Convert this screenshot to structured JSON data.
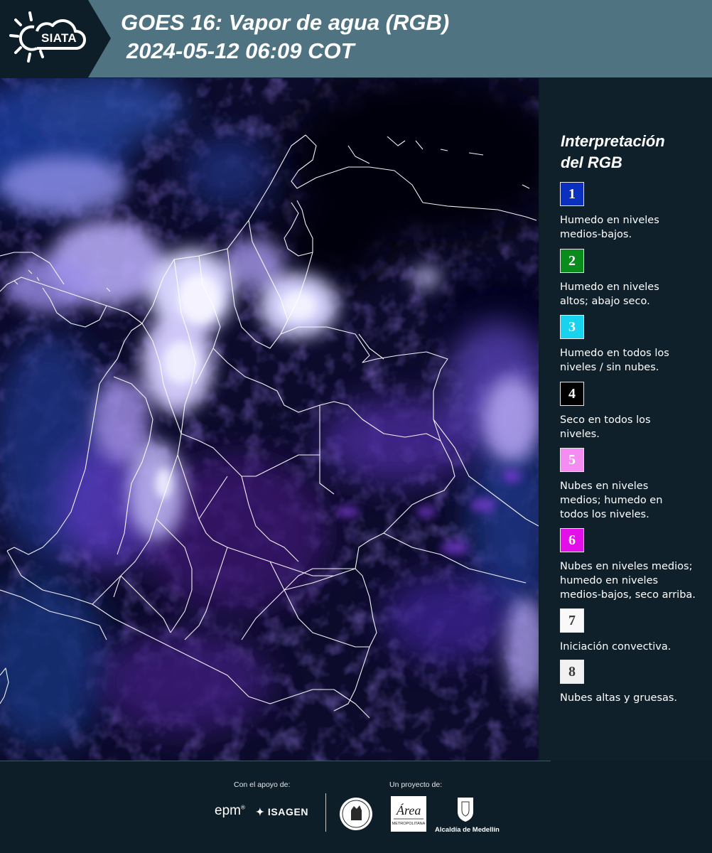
{
  "header": {
    "logo_text": "SIATA",
    "title_line1": "GOES 16: Vapor de agua (RGB)",
    "title_line2": "2024-05-12 06:09 COT",
    "background_color": "#4f7381",
    "logo_background_color": "#0d1e29"
  },
  "map": {
    "product": "GOES 16 water vapor RGB composite",
    "boundary_color": "#ffffff"
  },
  "legend": {
    "title": "Interpretación\ndel RGB",
    "items": [
      {
        "number": "1",
        "color": "#0b2fbe",
        "text_color": "#ffffff",
        "label": "Humedo en niveles\nmedios-bajos."
      },
      {
        "number": "2",
        "color": "#0a8c1c",
        "text_color": "#ffffff",
        "label": "Humedo en niveles\naltos; abajo seco."
      },
      {
        "number": "3",
        "color": "#18d2ee",
        "text_color": "#ffffff",
        "label": "Humedo en todos los\nniveles / sin nubes."
      },
      {
        "number": "4",
        "color": "#000000",
        "text_color": "#ffffff",
        "label": "Seco en todos los\nniveles."
      },
      {
        "number": "5",
        "color": "#f58cf2",
        "text_color": "#ffffff",
        "label": "Nubes en niveles\nmedios; humedo en\ntodos los niveles."
      },
      {
        "number": "6",
        "color": "#e20fe9",
        "text_color": "#ffffff",
        "label": "Nubes en niveles medios;\nhumedo en niveles\nmedios-bajos, seco arriba."
      },
      {
        "number": "7",
        "color": "#f9f9f9",
        "text_color": "#3a3a3a",
        "label": "Iniciación convectiva."
      },
      {
        "number": "8",
        "color": "#f1f1f1",
        "text_color": "#3a3a3a",
        "label": "Nubes altas y gruesas."
      }
    ]
  },
  "footer": {
    "support_label": "Con el apoyo de:",
    "project_label": "Un proyecto de:",
    "sponsors": [
      "epm",
      "ISAGEN"
    ],
    "partners": [
      "METROPOLITANA",
      "Alcaldía de Medellín"
    ]
  }
}
